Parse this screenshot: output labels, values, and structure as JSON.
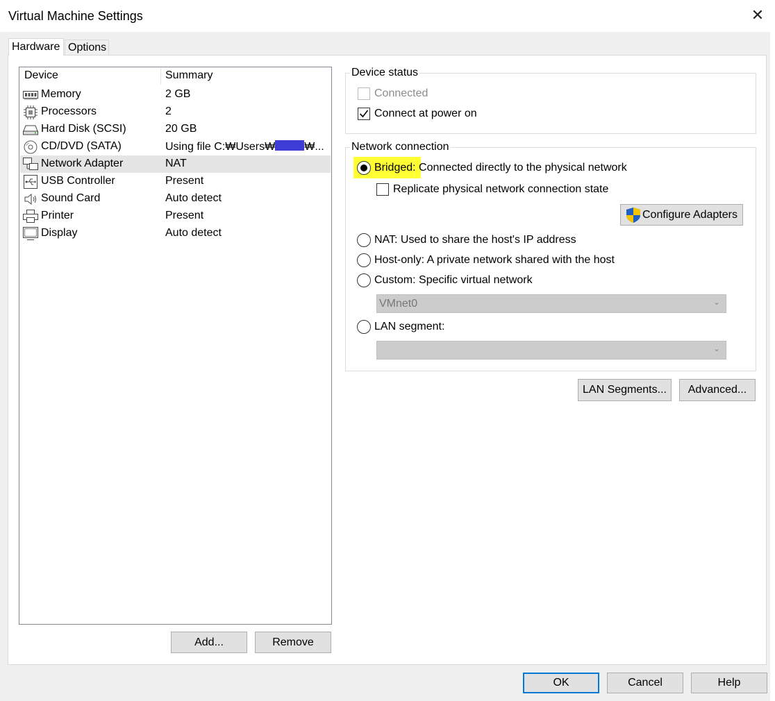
{
  "window": {
    "title": "Virtual Machine Settings",
    "close_glyph": "✕"
  },
  "tabs": [
    {
      "label": "Hardware",
      "active": true
    },
    {
      "label": "Options",
      "active": false
    }
  ],
  "device_list": {
    "header_device": "Device",
    "header_summary": "Summary",
    "items": [
      {
        "name": "Memory",
        "summary": "2 GB",
        "icon": "memory-icon"
      },
      {
        "name": "Processors",
        "summary": "2",
        "icon": "processor-icon"
      },
      {
        "name": "Hard Disk (SCSI)",
        "summary": "20 GB",
        "icon": "hard-disk-icon"
      },
      {
        "name": "CD/DVD (SATA)",
        "summary_prefix": "Using file C:₩Users₩",
        "summary_suffix": "₩...",
        "icon": "cd-dvd-icon"
      },
      {
        "name": "Network Adapter",
        "summary": "NAT",
        "icon": "network-adapter-icon",
        "selected": true
      },
      {
        "name": "USB Controller",
        "summary": "Present",
        "icon": "usb-icon"
      },
      {
        "name": "Sound Card",
        "summary": "Auto detect",
        "icon": "speaker-icon"
      },
      {
        "name": "Printer",
        "summary": "Present",
        "icon": "printer-icon"
      },
      {
        "name": "Display",
        "summary": "Auto detect",
        "icon": "display-icon"
      }
    ],
    "add_button": "Add...",
    "remove_button": "Remove"
  },
  "device_status": {
    "title": "Device status",
    "connected_label": "Connected",
    "connected_checked": false,
    "connected_disabled": true,
    "power_on_label": "Connect at power on",
    "power_on_checked": true
  },
  "network_connection": {
    "title": "Network connection",
    "bridged_prefix": "Bridged:",
    "bridged_rest": " Connected directly to the physical network",
    "bridged_selected": true,
    "replicate_label": "Replicate physical network connection state",
    "replicate_checked": false,
    "configure_adapters": "Configure Adapters",
    "nat_label": "NAT: Used to share the host's IP address",
    "hostonly_label": "Host-only: A private network shared with the host",
    "custom_label": "Custom: Specific virtual network",
    "custom_value": "VMnet0",
    "lan_label": "LAN segment:",
    "lan_value": "",
    "lan_segments_button": "LAN Segments...",
    "advanced_button": "Advanced..."
  },
  "footer": {
    "ok": "OK",
    "cancel": "Cancel",
    "help": "Help"
  },
  "colors": {
    "accent": "#0078d7",
    "highlight": "#ffff33",
    "redaction": "#3d3dd6"
  }
}
